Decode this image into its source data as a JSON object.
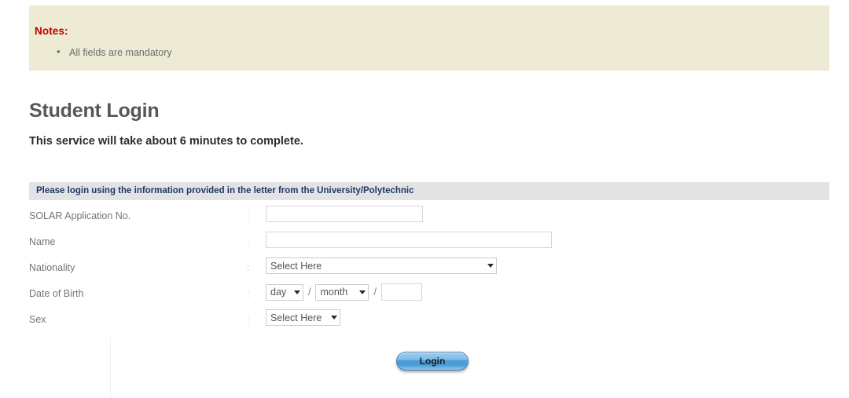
{
  "notes": {
    "title": "Notes:",
    "items": [
      "All fields are mandatory"
    ]
  },
  "page": {
    "title": "Student Login",
    "service_note": "This service will take about 6 minutes to complete."
  },
  "section": {
    "header": "Please login using the information provided in the letter from the University/Polytechnic"
  },
  "form": {
    "separator": ":",
    "rows": [
      {
        "label": "SOLAR Application No.",
        "type": "text",
        "value": "",
        "placeholder": ""
      },
      {
        "label": "Name",
        "type": "text",
        "value": "",
        "placeholder": ""
      },
      {
        "label": "Nationality",
        "type": "select",
        "value": "Select Here"
      },
      {
        "label": "Date of Birth",
        "type": "date",
        "day": "day",
        "month": "month",
        "year": "",
        "separator1": "/",
        "separator2": "/"
      },
      {
        "label": "Sex",
        "type": "select",
        "value": "Select Here"
      }
    ]
  },
  "actions": {
    "login_label": "Login"
  },
  "colors": {
    "notes_background": "#edebd3",
    "notes_title": "#c00000",
    "section_bar": "#e3e3e6",
    "section_text": "#1f3864",
    "page_title": "#55575a",
    "label": "#747474",
    "button_blue": "#4e9ed6"
  }
}
